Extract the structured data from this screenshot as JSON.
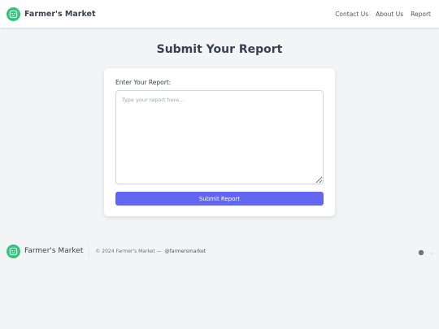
{
  "header": {
    "brand_name": "Farmer's Market",
    "logo_icon": "smiley-face-icon",
    "nav": [
      {
        "label": "Contact Us"
      },
      {
        "label": "About Us"
      },
      {
        "label": "Report"
      }
    ]
  },
  "main": {
    "title": "Submit Your Report",
    "form": {
      "label": "Enter Your Report:",
      "textarea_placeholder": "Type your report here...",
      "textarea_value": "",
      "submit_label": "Submit Report"
    }
  },
  "footer": {
    "brand_name": "Farmer's Market",
    "copyright": "© 2024 Farmer's Market —",
    "handle": "@farmersmarket",
    "social_icons": [
      "social-round-icon",
      "social-small-icon"
    ]
  },
  "colors": {
    "accent": "#6366f1",
    "logo_green": "#34c37a",
    "background": "#f3f4f6",
    "text": "#374151"
  }
}
